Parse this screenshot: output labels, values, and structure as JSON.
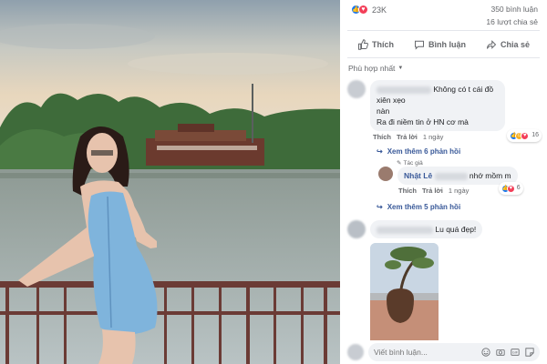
{
  "stats": {
    "reaction_count": "23K",
    "comment_count": "350 bình luận",
    "share_count": "16 lượt chia sẻ"
  },
  "actions": {
    "like": "Thích",
    "comment": "Bình luận",
    "share": "Chia sẻ"
  },
  "sort": {
    "label": "Phù hợp nhất"
  },
  "comments": [
    {
      "text_line1": "Không có t cái đồ xiên xẹo",
      "text_line2_prefix": "nàn",
      "text_line3": "Ra đi niềm tin ở HN cơ mà",
      "like": "Thích",
      "reply": "Trả lời",
      "time": "1 ngày",
      "reaction_count": "16",
      "more_replies": "Xem thêm 6 phản hồi"
    },
    {
      "author_tag": "Tác giả",
      "name": "Nhật Lê",
      "text": "nhớ mồm m",
      "like": "Thích",
      "reply": "Trả lời",
      "time": "1 ngày",
      "reaction_count": "6",
      "more_replies": "Xem thêm 5 phản hồi"
    },
    {
      "text": "Lu quá đẹp!"
    }
  ],
  "composer": {
    "placeholder": "Viết bình luận..."
  },
  "colors": {
    "like_blue": "#1877f2",
    "love_red": "#f33e58",
    "haha_yellow": "#f7b125",
    "link_blue": "#385898",
    "muted_gray": "#65676b",
    "bubble_gray": "#f0f2f5"
  }
}
